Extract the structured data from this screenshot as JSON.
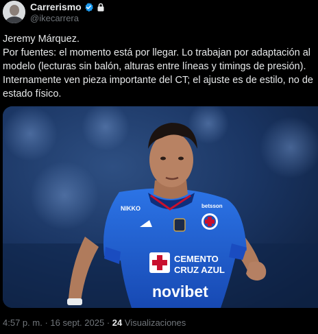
{
  "author": {
    "display_name": "Carrerismo",
    "handle": "@ikecarrera",
    "verified_icon": "verified-badge-icon",
    "protected_icon": "lock-icon"
  },
  "tweet": {
    "lines": [
      "Jeremy Márquez.",
      "Por fuentes: el momento está por llegar. Lo trabajan por adaptación al",
      "modelo (lecturas sin balón, alturas entre líneas y timings de presión).",
      "Internamente ven pieza importante del CT; el ajuste es de estilo, no de",
      "estado físico."
    ]
  },
  "media": {
    "jersey": {
      "sponsor_main": "novibet",
      "sponsor_chest_1": "CEMENTO",
      "sponsor_chest_2": "CRUZ AZUL",
      "shoulder_sponsor": "NIKKO",
      "brand_right": "betsson"
    }
  },
  "meta": {
    "time": "4:57 p. m.",
    "separator": "·",
    "date": "16 sept. 2025",
    "views_count": "24",
    "views_label": "Visualizaciones"
  },
  "colors": {
    "background": "#000000",
    "text": "#e7e9ea",
    "muted": "#71767b",
    "verified": "#1d9bf0",
    "jersey_blue": "#1f5fd6"
  }
}
